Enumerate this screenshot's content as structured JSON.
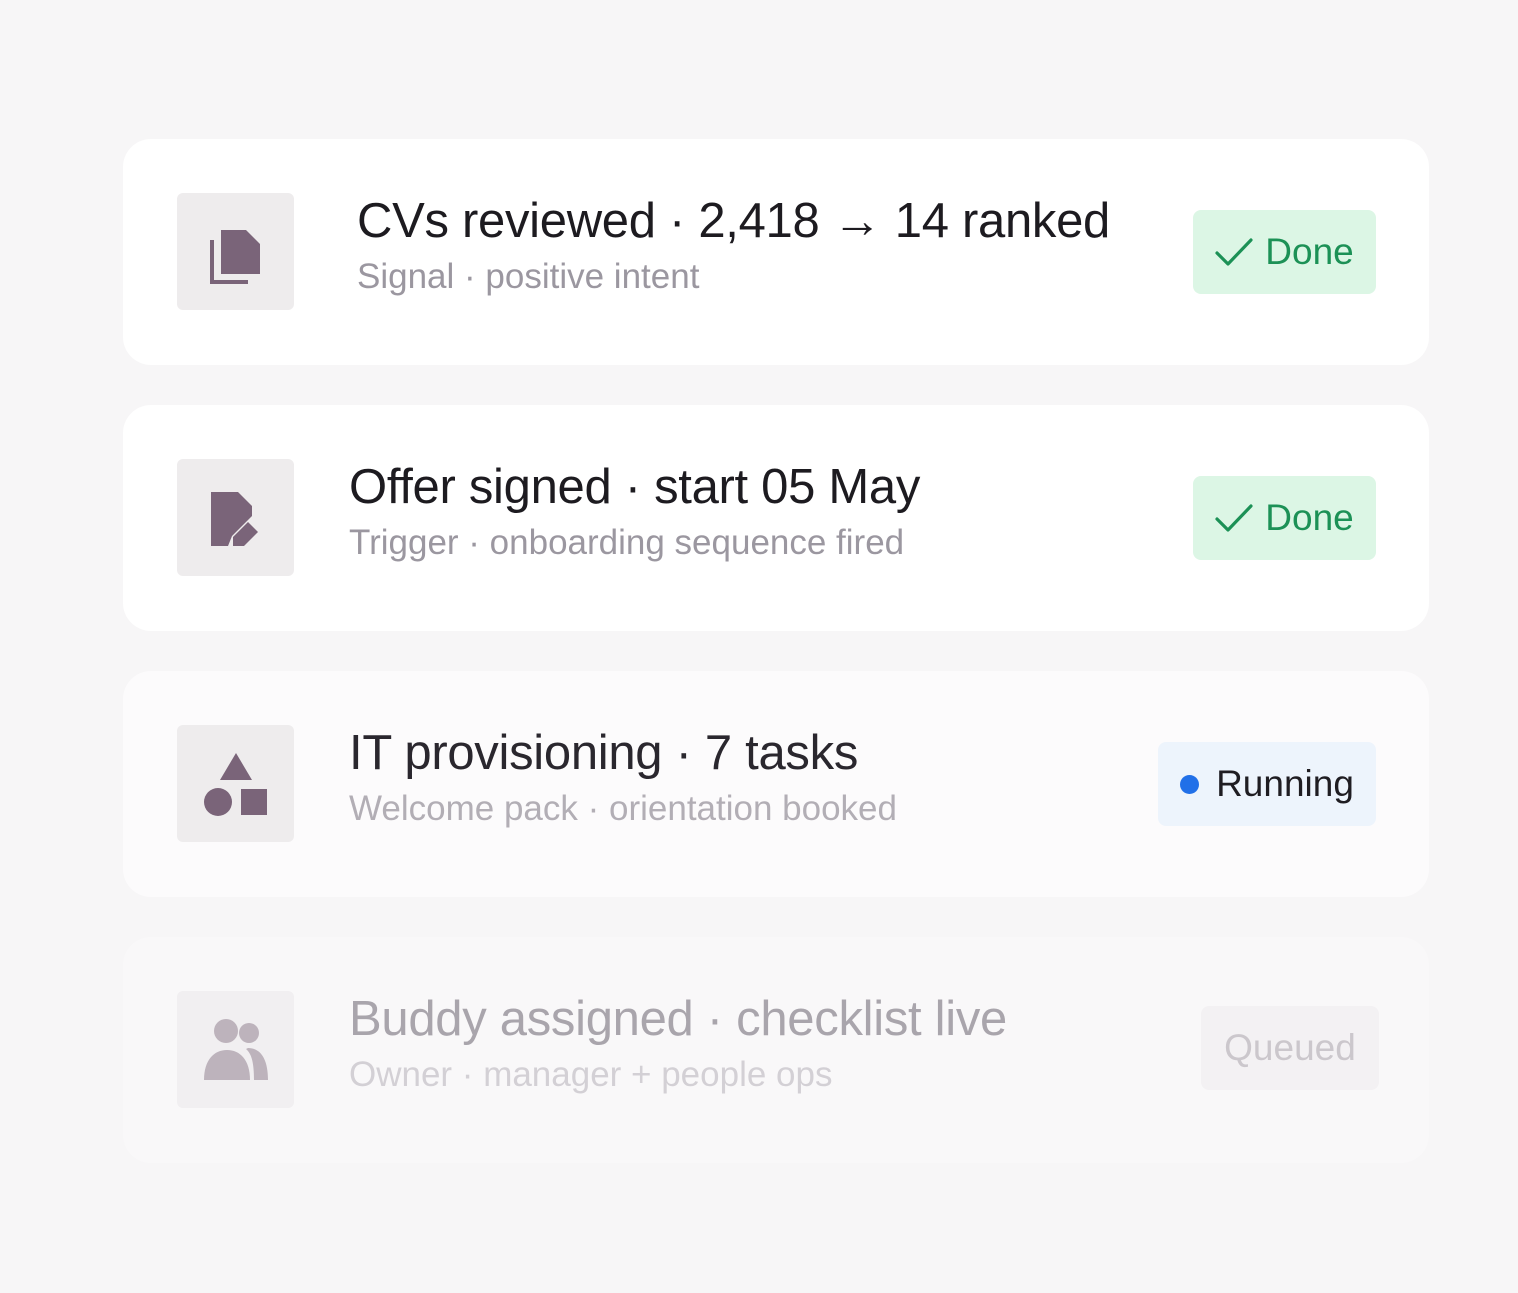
{
  "pipeline": {
    "steps": [
      {
        "icon": "documents-icon",
        "title": "CVs reviewed · 2,418 → 14 ranked",
        "subtitle": "Signal · positive intent",
        "status": "Done"
      },
      {
        "icon": "document-edit-icon",
        "title": "Offer signed · start 05 May",
        "subtitle": "Trigger · onboarding sequence fired",
        "status": "Done"
      },
      {
        "icon": "shapes-icon",
        "title": "IT provisioning · 7 tasks",
        "subtitle": "Welcome pack · orientation booked",
        "status": "Running"
      },
      {
        "icon": "people-icon",
        "title": "Buddy assigned · checklist live",
        "subtitle": "Owner · manager + people ops",
        "status": "Queued"
      }
    ]
  },
  "colors": {
    "done_text": "#1c9156",
    "done_bg": "#dcf6e5",
    "running_dot": "#2170e8",
    "running_bg": "#edf4fc",
    "icon_fill": "#7a6479"
  }
}
